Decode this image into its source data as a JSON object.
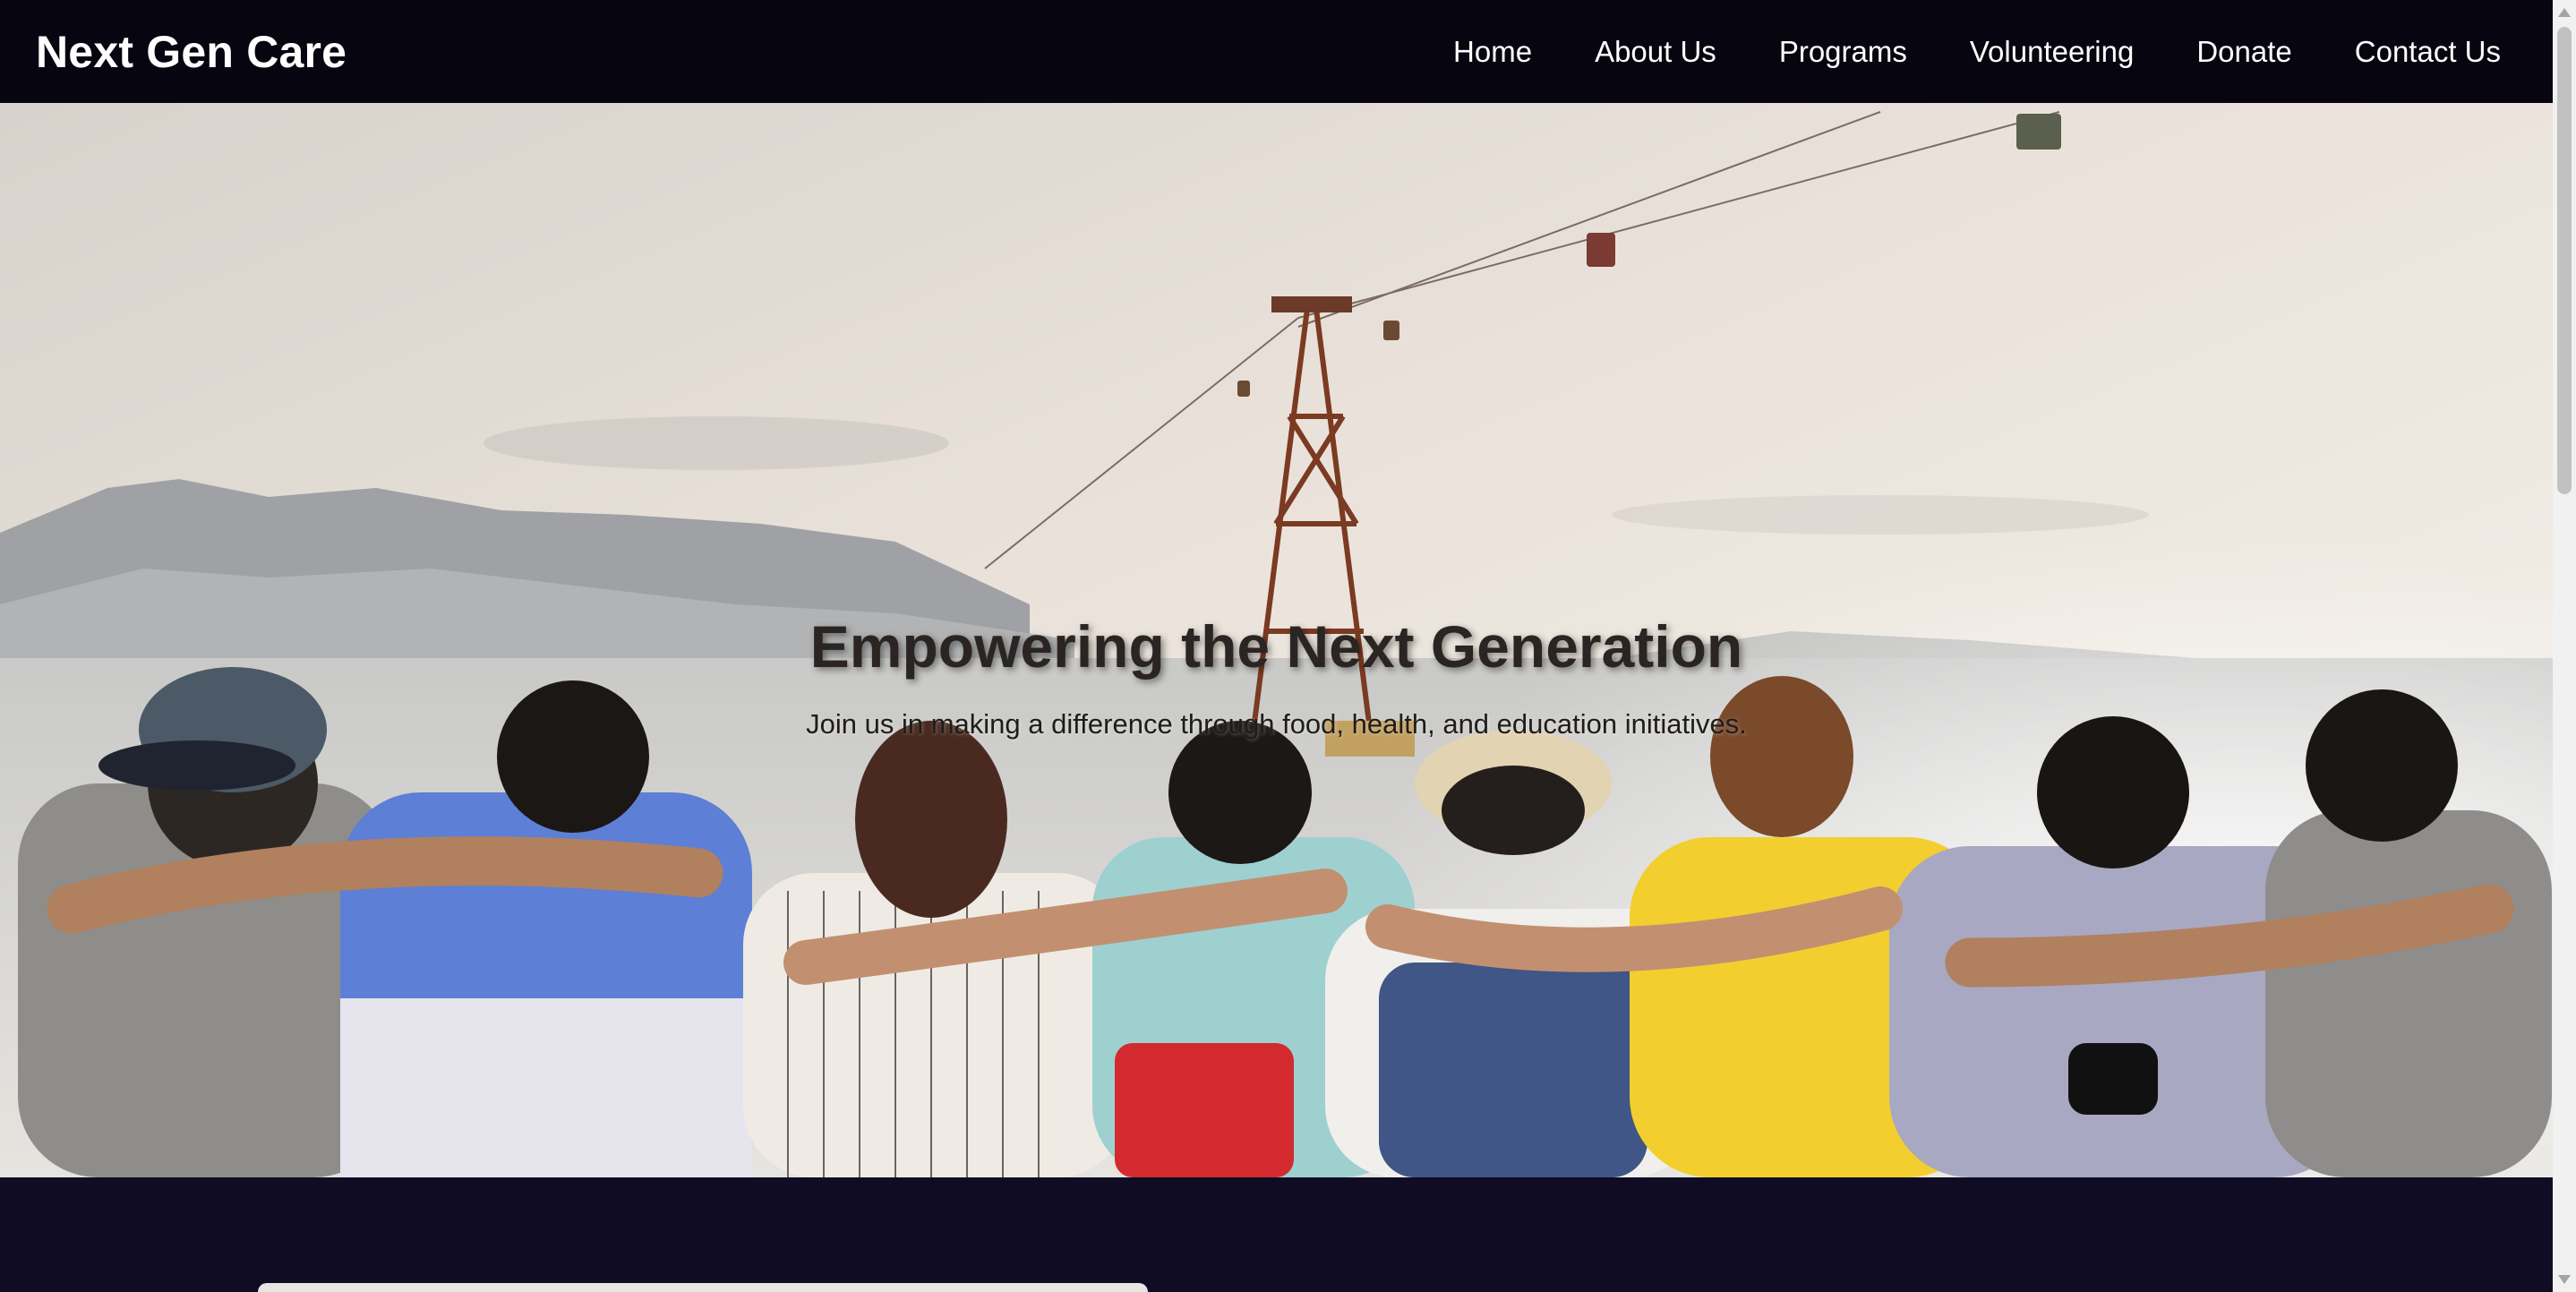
{
  "header": {
    "brand": "Next Gen Care",
    "nav": [
      "Home",
      "About Us",
      "Programs",
      "Volunteering",
      "Donate",
      "Contact Us"
    ]
  },
  "hero": {
    "title": "Empowering the Next Generation",
    "subtitle": "Join us in making a difference through food, health, and education initiatives."
  },
  "colors": {
    "navbar_bg": "#07050f",
    "section_bg": "#100c24",
    "text_light": "#ffffff"
  }
}
